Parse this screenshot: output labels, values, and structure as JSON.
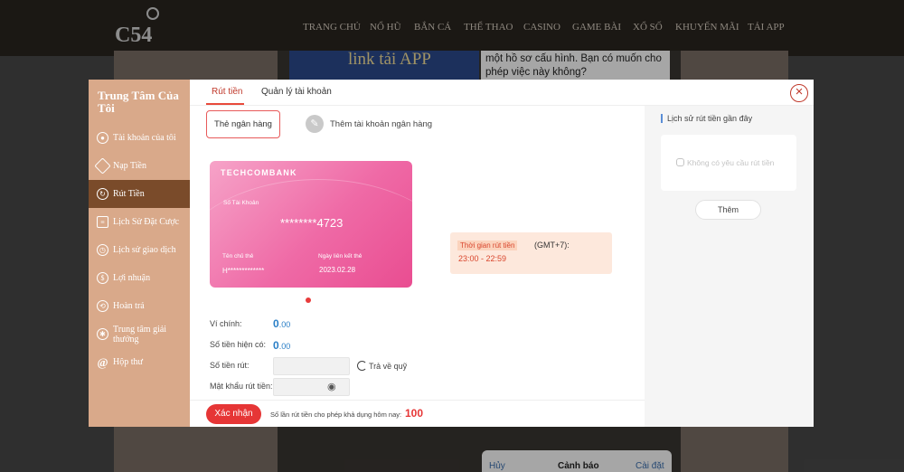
{
  "site": {
    "logo_text": "C54",
    "nav": [
      "TRANG CHỦ",
      "NỔ HŨ",
      "BẮN CÁ",
      "THỂ THAO",
      "CASINO",
      "GAME BÀI",
      "XỔ SỐ",
      "KHUYẾN MÃI",
      "TẢI APP"
    ],
    "banner_text": "link tải APP",
    "dialog_text": "một hồ sơ cấu hình. Bạn có muốn cho phép việc này không?",
    "dialog_buttons": {
      "cancel": "Hủy",
      "title": "Cảnh báo",
      "settings": "Cài đặt"
    }
  },
  "sidebar": {
    "title": "Trung Tâm Của Tôi",
    "items": [
      {
        "label": "Tài khoản của tôi",
        "icon": "user-icon"
      },
      {
        "label": "Nạp Tiền",
        "icon": "diamond-icon"
      },
      {
        "label": "Rút Tiền",
        "icon": "withdraw-icon",
        "active": true
      },
      {
        "label": "Lịch Sử Đặt Cược",
        "icon": "document-icon"
      },
      {
        "label": "Lịch sử giao dịch",
        "icon": "clock-icon"
      },
      {
        "label": "Lợi nhuận",
        "icon": "profit-icon"
      },
      {
        "label": "Hoàn trả",
        "icon": "refund-icon"
      },
      {
        "label": "Trung tâm giải thưởng",
        "icon": "reward-icon"
      },
      {
        "label": "Hộp thư",
        "icon": "at-icon"
      }
    ]
  },
  "tabs": {
    "withdraw": "Rút tiền",
    "account_mgmt": "Quản lý tài khoản"
  },
  "sub": {
    "bank_card": "Thẻ ngân hàng",
    "add_bank": "Thêm tài khoản ngân hàng"
  },
  "card": {
    "bank": "TECHCOMBANK",
    "account_label": "Số Tài Khoản",
    "account": "********4723",
    "holder_label": "Tên chủ thẻ",
    "holder": "H*************",
    "date_label": "Ngày liên kết thẻ",
    "date": "2023.02.28"
  },
  "time": {
    "label": "Thời gian rút tiền",
    "gmt": "(GMT+7):",
    "value": "23:00 - 22:59"
  },
  "form": {
    "main_wallet_label": "Ví chính:",
    "main_wallet_int": "0",
    "main_wallet_dec": ".00",
    "balance_label": "Số tiền hiện có:",
    "balance_int": "0",
    "balance_dec": ".00",
    "amount_label": "Số tiền rút:",
    "amount_value": "",
    "return_label": "Trả về quỹ",
    "password_label": "Mật khẩu rút tiền:",
    "password_value": ""
  },
  "confirm_label": "Xác nhận",
  "count_label": "Số lần rút tiền cho phép khả dụng hôm nay:",
  "count_value": "100",
  "right_panel": {
    "title": "Lịch sử rút tiền gần đây",
    "empty": "Không có yêu cầu rút tiền",
    "more": "Thêm"
  }
}
